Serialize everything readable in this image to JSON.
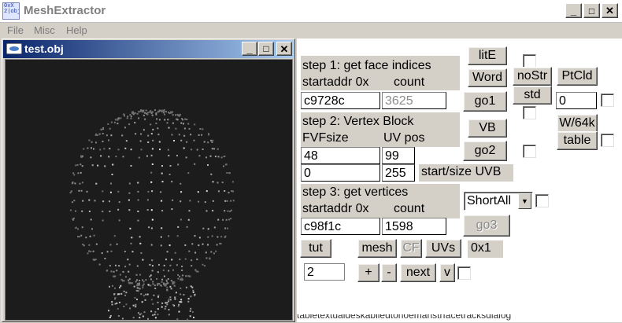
{
  "app": {
    "title": "MeshExtractor",
    "icon_text": "0xX\n2|obj",
    "caption_buttons": [
      "_",
      "□",
      "✕"
    ]
  },
  "menu": {
    "items": [
      "File",
      "Misc",
      "Help"
    ]
  },
  "child_window": {
    "title": "test.obj",
    "caption_buttons": [
      "_",
      "□",
      "✕"
    ]
  },
  "step1": {
    "title": "step 1: get face indices",
    "startaddr_label": "startaddr 0x",
    "count_label": "count",
    "startaddr_value": "c9728c",
    "count_value": "3625",
    "go1": "go1",
    "litE": "litE",
    "word": "Word",
    "noStr": "noStr",
    "std": "std",
    "ptcld": "PtCld",
    "ptcld_value": "0"
  },
  "step2": {
    "title": "step 2: Vertex Block",
    "fvf_label": "FVFsize",
    "uvpos_label": "UV pos",
    "fvf_value": "48",
    "uvpos_value": "99",
    "start_value": "0",
    "size_value": "255",
    "uvb_label": "start/size UVB",
    "vb": "VB",
    "go2": "go2",
    "w64k": "W/64k",
    "table": "table"
  },
  "step3": {
    "title": "step 3: get vertices",
    "startaddr_label": "startaddr 0x",
    "count_label": "count",
    "startaddr_value": "c98f1c",
    "count_value": "1598",
    "dropdown_value": "ShortAll",
    "go3": "go3"
  },
  "tools": {
    "tut": "tut",
    "mesh": "mesh",
    "cf": "CF",
    "uvs": "UVs",
    "hex_label": "0x1",
    "num_value": "2",
    "plus": "+",
    "minus": "-",
    "next": "next",
    "v": "v"
  },
  "status": {
    "clipped_text": "tabletextualdeskablledtonoemanstrfacetracksdialog"
  },
  "colors": {
    "face": "#d4d0c8",
    "child_title_start": "#0a246a",
    "child_title_end": "#a6caf0",
    "viewport_bg": "#1c1c1c"
  }
}
